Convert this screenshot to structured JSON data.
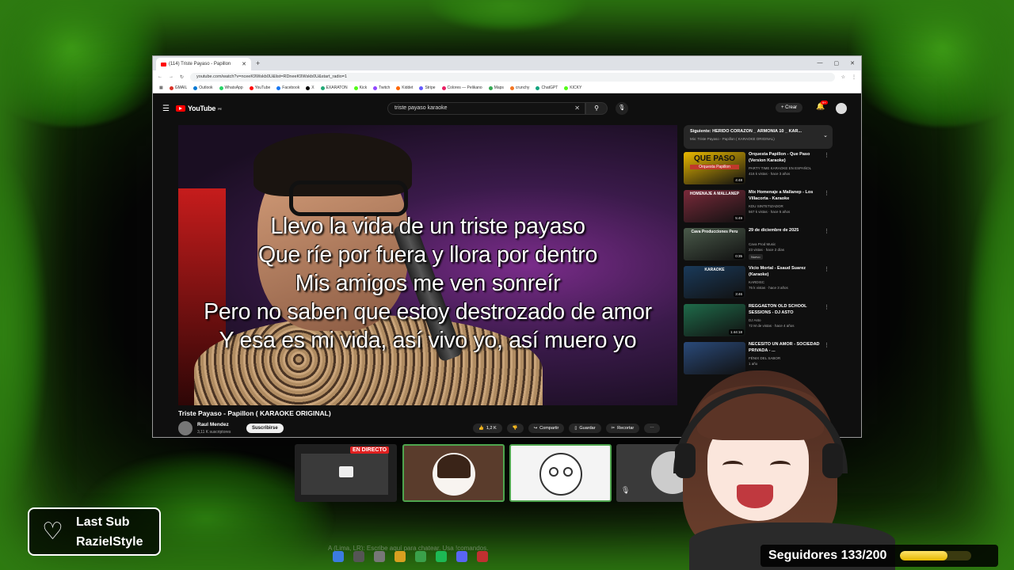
{
  "browser": {
    "tab_title": "(114) Triste Payaso - Papillon",
    "url": "youtube.com/watch?v=nceeK9Wskb0U&list=RDneeK9Wskb0U&start_radio=1",
    "bookmarks": [
      "GMAIL",
      "Outlook",
      "WhatsApp",
      "YouTube",
      "Facebook",
      "X",
      "EXARATON",
      "Kick",
      "Twitch",
      "Kiddet",
      "Stripe",
      "Colores — Pelikano",
      "Maps",
      "crunchy",
      "ChatGPT",
      "KICKY"
    ]
  },
  "youtube": {
    "logo": "YouTube",
    "logo_region": "PE",
    "search_query": "triste payaso karaoke",
    "create_label": "Crear",
    "notif_badge": "9+",
    "lyrics": [
      "Llevo la vida de un triste payaso",
      "Que ríe por fuera y llora por dentro",
      "Mis amigos me ven sonreír",
      "Pero no saben que estoy destrozado de amor",
      "Y esa es mi vida, así vivo yo, así muero yo"
    ],
    "video_title": "Triste Payaso - Papillon ( KARAOKE ORIGINAL)",
    "channel_name": "Raul Mendez",
    "channel_subs": "3,11 K suscriptores",
    "subscribe_label": "Suscribirse",
    "actions": {
      "likes": "1,2 K",
      "share": "Compartir",
      "save": "Guardar",
      "clip": "Recortar"
    },
    "mix": {
      "title": "Siguiente: HERIDO CORAZON _ ARMONIA 10 _ KAR...",
      "subtitle": "Mix: Triste Payaso - Papillon ( KARAOKE ORIGINAL)"
    },
    "related": [
      {
        "title": "Orquesta Papillon - Que Paso (Version Karaoke)",
        "channel": "PARTY TIME KARAOKE EN ESPAÑOL",
        "meta": "416 k vistas · hace 3 años",
        "duration": "4:48",
        "thumb_text": "QUE PASO",
        "thumb_sub": "Orquesta Papillon",
        "color": "#e9b800",
        "is_new": ""
      },
      {
        "title": "Mix Homenaje a Mallanep - Los Villacorta - Karaoke",
        "channel": "KDU SINTETIZADOR",
        "meta": "567 k vistas · hace 5 años",
        "duration": "5:49",
        "thumb_text": "HOMENAJE A MALLANEP",
        "thumb_sub": "",
        "color": "#7a2a3a",
        "is_new": ""
      },
      {
        "title": "29 de diciembre de 2025",
        "channel": "Cava Prod Music",
        "meta": "23 vistas · hace 2 días",
        "duration": "0:35",
        "thumb_text": "Cava Producciones Peru",
        "thumb_sub": "",
        "color": "#4a5a4a",
        "is_new": "Nuevo"
      },
      {
        "title": "Vicio Mortal - Esaud Suarez (Karaoke)",
        "channel": "KARDISC",
        "meta": "76 k vistas · hace 3 años",
        "duration": "3:46",
        "thumb_text": "KARAOKE",
        "thumb_sub": "",
        "color": "#1a3a5a",
        "is_new": ""
      },
      {
        "title": "REGGAETON OLD SCHOOL SESSIONS - DJ ASTO",
        "channel": "DJ Asto",
        "meta": "72 M de vistas · hace 4 años",
        "duration": "1:44:18",
        "thumb_text": "",
        "thumb_sub": "",
        "color": "#1f6b4a",
        "is_new": ""
      },
      {
        "title": "NECESITO UN AMOR - SOCIEDAD PRIVADA - ...",
        "channel": "FÉNIX DEL SABOR",
        "meta": "1 año",
        "duration": "",
        "thumb_text": "",
        "thumb_sub": "",
        "color": "#2a4a7a",
        "is_new": ""
      }
    ]
  },
  "participants": {
    "live_label": "EN DIRECTO"
  },
  "overlay": {
    "last_sub_label": "Last Sub",
    "last_sub_name": "RazielStyle",
    "followers_text": "Seguidores 133/200",
    "followers_progress": 0.665,
    "chat_hint": "A (Lima, LR): Escribe aquí para chatear. Usa !comandos."
  },
  "colors": {
    "frame_green": "#2f7d12",
    "yt_red": "#ff0000",
    "yt_bg": "#0f0f0f",
    "follow_gold": "#e5b800"
  }
}
